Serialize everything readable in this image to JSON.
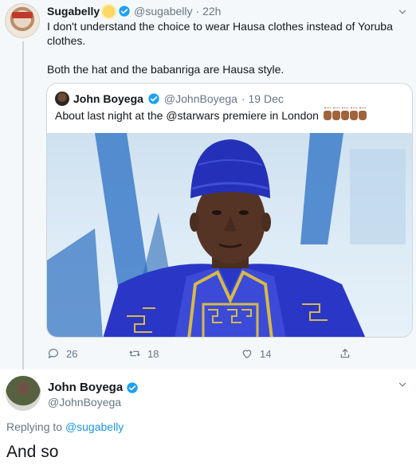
{
  "tweet": {
    "author_name": "Sugabelly",
    "author_handle": "@sugabelly",
    "time": "· 22h",
    "text_line1": "I don't understand the choice to wear Hausa clothes instead of Yoruba clothes.",
    "text_line2": "Both the hat and the babanriga are Hausa style.",
    "stats": {
      "replies": "26",
      "retweets": "18",
      "likes": "14"
    }
  },
  "quoted": {
    "author_name": "John Boyega",
    "author_handle": "@JohnBoyega",
    "date": "· 19 Dec",
    "text": "About last night at the @starwars premiere in London"
  },
  "reply": {
    "author_name": "John Boyega",
    "author_handle": "@JohnBoyega",
    "replying_prefix": "Replying to",
    "replying_to": "@sugabelly",
    "text": "And so"
  },
  "colors": {
    "accent": "#1da1f2",
    "muted": "#657786",
    "background_thread": "#f5f8fa",
    "border": "#ccd6dd"
  },
  "icons": [
    "verified-badge-icon",
    "chevron-down-icon",
    "reply-icon",
    "retweet-icon",
    "like-icon",
    "share-icon"
  ]
}
